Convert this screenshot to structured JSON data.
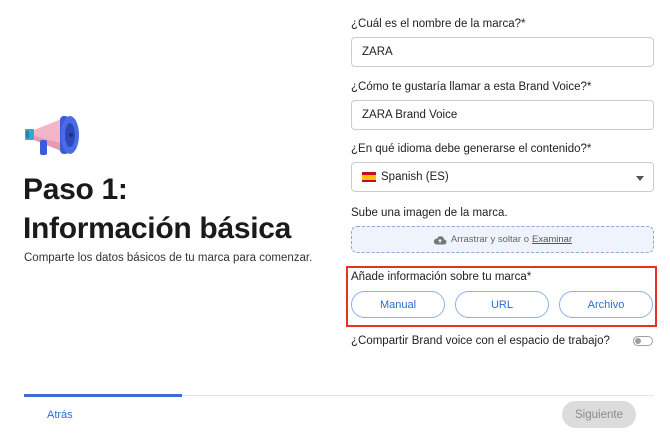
{
  "hero": {
    "icon": "megaphone-icon",
    "title_line1": "Paso 1:",
    "title_line2": "Información básica",
    "subtitle": "Comparte los datos básicos de tu marca para comenzar."
  },
  "form": {
    "brand_name": {
      "label": "¿Cuál es el nombre de la marca?*",
      "value": "ZARA"
    },
    "voice_name": {
      "label": "¿Cómo te gustaría llamar a esta Brand Voice?*",
      "value": "ZARA Brand Voice"
    },
    "language": {
      "label": "¿En qué idioma debe generarse el contenido?*",
      "value": "Spanish (ES)",
      "flag": "spain-flag-icon"
    },
    "image_upload": {
      "label": "Sube una imagen de la marca.",
      "hint": "Arrastrar y soltar o",
      "link": "Examinar",
      "icon": "cloud-upload-icon"
    },
    "info_source": {
      "label": "Añade información sobre tu marca*",
      "options": [
        "Manual",
        "URL",
        "Archivo"
      ]
    },
    "share": {
      "label": "¿Compartir Brand voice con el espacio de trabajo?",
      "enabled": false
    }
  },
  "footer": {
    "back_label": "Atrás",
    "next_label": "Siguiente",
    "progress_fraction": 0.25
  },
  "colors": {
    "accent": "#2d6bd1",
    "highlight_border": "#e53224",
    "disabled_button": "#dcdcdc"
  }
}
